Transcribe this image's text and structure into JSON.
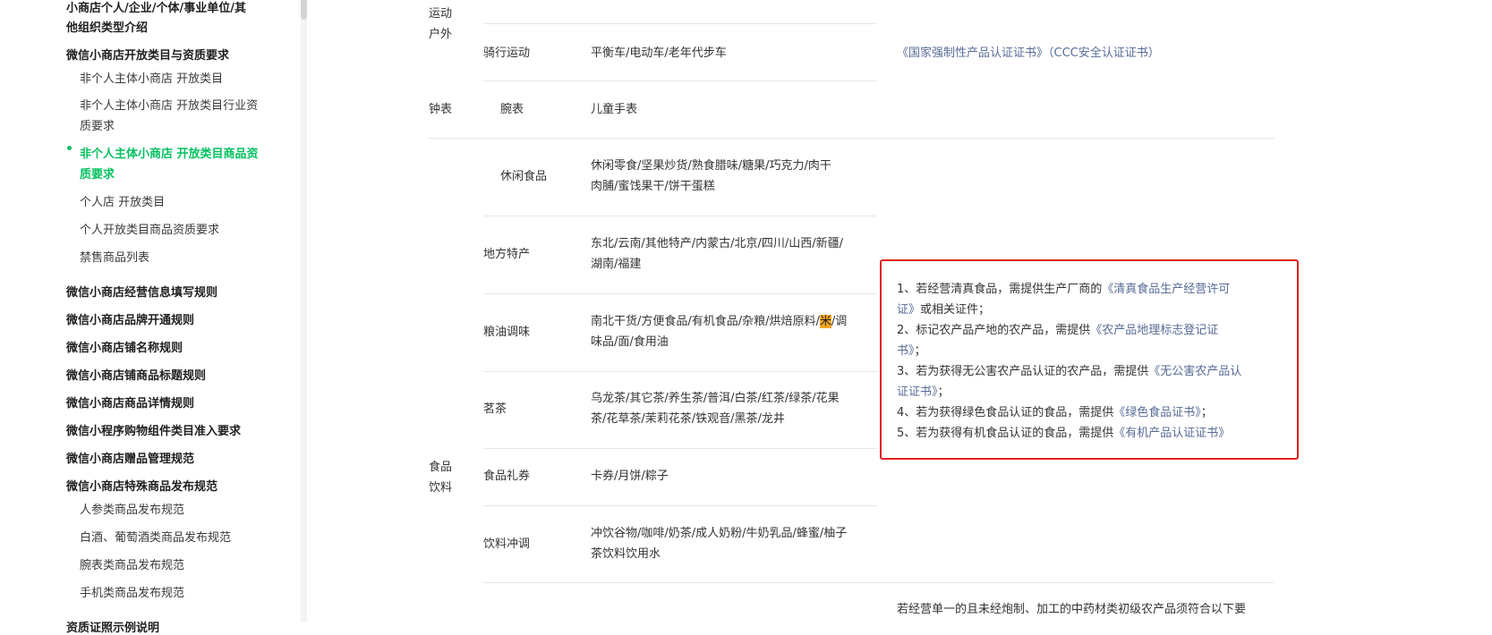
{
  "sidebar": {
    "items": [
      {
        "label": "小商店个人/企业/个体/事业单位/其",
        "type": "h"
      },
      {
        "label": "他组织类型介绍",
        "type": "h"
      },
      {
        "label": "微信小商店开放类目与资质要求",
        "type": "h"
      },
      {
        "label": "非个人主体小商店 开放类目",
        "type": "s"
      },
      {
        "label": "非个人主体小商店 开放类目行业资",
        "type": "s"
      },
      {
        "label": "质要求",
        "type": "s"
      },
      {
        "label": "非个人主体小商店 开放类目商品资",
        "type": "active"
      },
      {
        "label": "质要求",
        "type": "active"
      },
      {
        "label": "个人店 开放类目",
        "type": "s"
      },
      {
        "label": "个人开放类目商品资质要求",
        "type": "s"
      },
      {
        "label": "禁售商品列表",
        "type": "s"
      },
      {
        "label": "微信小商店经营信息填写规则",
        "type": "h"
      },
      {
        "label": "微信小商店品牌开通规则",
        "type": "h"
      },
      {
        "label": "微信小商店铺名称规则",
        "type": "h"
      },
      {
        "label": "微信小商店铺商品标题规则",
        "type": "h"
      },
      {
        "label": "微信小商店商品详情规则",
        "type": "h"
      },
      {
        "label": "微信小程序购物组件类目准入要求",
        "type": "h"
      },
      {
        "label": "微信小商店赠品管理规范",
        "type": "h"
      },
      {
        "label": "微信小商店特殊商品发布规范",
        "type": "h"
      },
      {
        "label": "人参类商品发布规范",
        "type": "s"
      },
      {
        "label": "白酒、葡萄酒类商品发布规范",
        "type": "s"
      },
      {
        "label": "腕表类商品发布规范",
        "type": "s"
      },
      {
        "label": "手机类商品发布规范",
        "type": "s"
      },
      {
        "label": "资质证照示例说明",
        "type": "h"
      }
    ]
  },
  "table": {
    "sport": {
      "c1_line1": "运动",
      "c1_line2": "户外",
      "row_label": "骑行运动",
      "row_items": "平衡车/电动车/老年代步车",
      "req_prefix": "《国家强制性产品认证证书》",
      "req_suffix": "（CCC安全认证证书）"
    },
    "watch": {
      "c1": "钟表",
      "row_label": "腕表",
      "row_items": "儿童手表"
    },
    "food": {
      "c1_line1": "食品",
      "c1_line2": "饮料",
      "rows": [
        {
          "label": "休闲食品",
          "l1": "休闲零食/坚果炒货/熟食腊味/糖果/巧克力/肉干",
          "l2": "肉脯/蜜饯果干/饼干蛋糕"
        },
        {
          "label": "地方特产",
          "l1": "东北/云南/其他特产/内蒙古/北京/四川/山西/新疆/",
          "l2": "湖南/福建"
        },
        {
          "label": "粮油调味",
          "l1a": "南北干货/方便食品/有机食品/杂粮/烘焙原料/",
          "l1h": "米",
          "l1b": "/调",
          "l2": "味品/面/食用油"
        },
        {
          "label": "茗茶",
          "l1": "乌龙茶/其它茶/养生茶/普洱/白茶/红茶/绿茶/花果",
          "l2": "茶/花草茶/茉莉花茶/铁观音/黑茶/龙井"
        },
        {
          "label": "食品礼券",
          "l1": "卡券/月饼/粽子",
          "l2": ""
        },
        {
          "label": "饮料冲调",
          "l1": "冲饮谷物/咖啡/奶茶/成人奶粉/牛奶乳品/蜂蜜/柚子",
          "l2": "茶饮料饮用水"
        }
      ],
      "requirements": [
        {
          "a": "1、若经营清真食品，需提供生产厂商的",
          "link": "《清真食品生产经营许可",
          "b": ""
        },
        {
          "a": "",
          "link": "证》",
          "b": "或相关证件；"
        },
        {
          "a": "2、标记农产品产地的农产品，需提供",
          "link": "《农产品地理标志登记证",
          "b": ""
        },
        {
          "a": "",
          "link": "书》",
          "b": "；"
        },
        {
          "a": "3、若为获得无公害农产品认证的农产品，需提供",
          "link": "《无公害农产品认",
          "b": ""
        },
        {
          "a": "",
          "link": "证证书》",
          "b": "；"
        },
        {
          "a": "4、若为获得绿色食品认证的食品，需提供",
          "link": "《绿色食品证书》",
          "b": "；"
        },
        {
          "a": "5、若为获得有机食品认证的食品，需提供",
          "link": "《有机产品认证证书》",
          "b": ""
        }
      ]
    },
    "bottom": {
      "req_line": "若经营单一的且未经炮制、加工的中药材类初级农产品须符合以下要"
    }
  }
}
